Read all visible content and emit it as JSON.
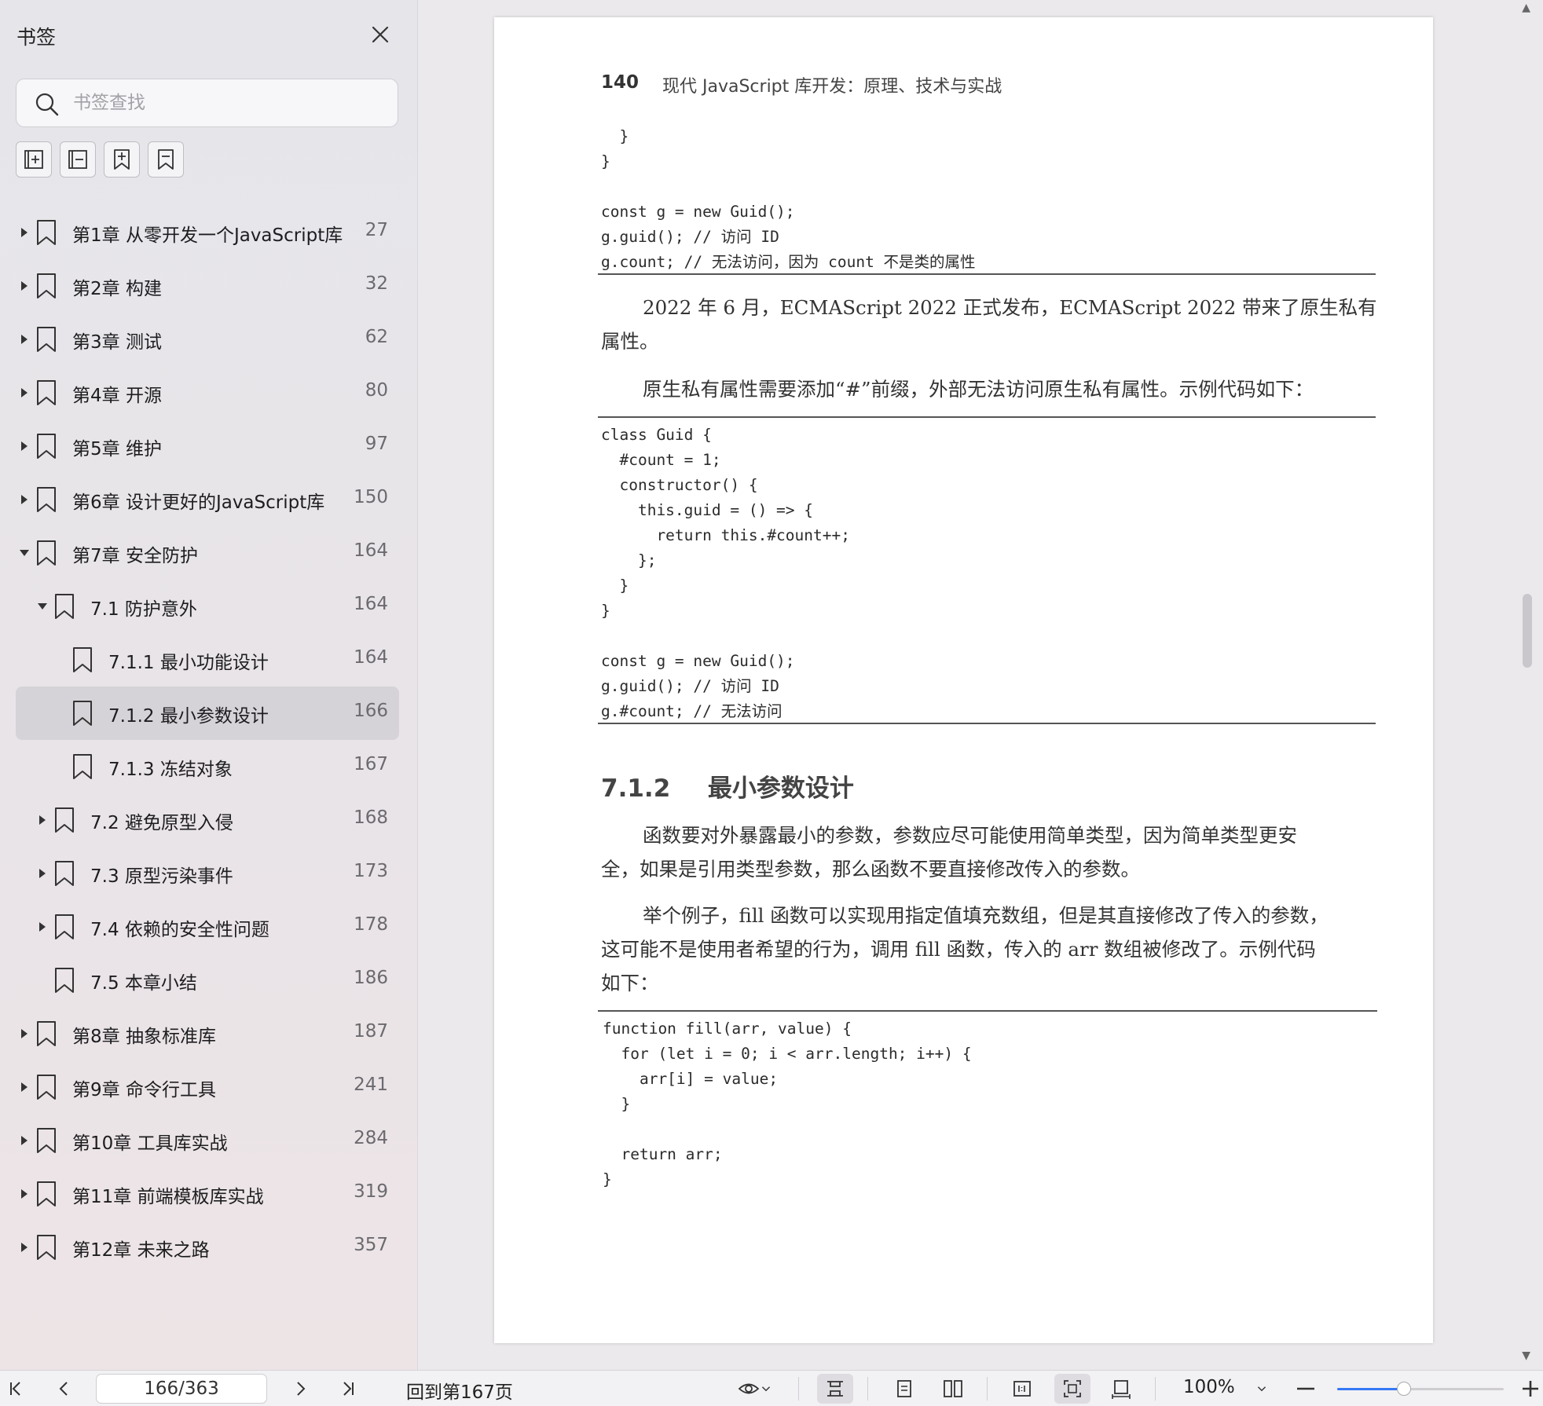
{
  "sidebar": {
    "title": "书签",
    "search_placeholder": "书签查找",
    "tools": [
      "expand-all-icon",
      "collapse-all-icon",
      "add-bookmark-icon",
      "remove-bookmark-icon"
    ],
    "bookmarks": [
      {
        "label": "第1章 从零开发一个JavaScript库",
        "page": "27",
        "level": 0,
        "state": "collapsed"
      },
      {
        "label": "第2章 构建",
        "page": "32",
        "level": 0,
        "state": "collapsed"
      },
      {
        "label": "第3章 测试",
        "page": "62",
        "level": 0,
        "state": "collapsed"
      },
      {
        "label": "第4章 开源",
        "page": "80",
        "level": 0,
        "state": "collapsed"
      },
      {
        "label": "第5章 维护",
        "page": "97",
        "level": 0,
        "state": "collapsed"
      },
      {
        "label": "第6章 设计更好的JavaScript库",
        "page": "150",
        "level": 0,
        "state": "collapsed"
      },
      {
        "label": "第7章 安全防护",
        "page": "164",
        "level": 0,
        "state": "expanded"
      },
      {
        "label": "7.1 防护意外",
        "page": "164",
        "level": 1,
        "state": "expanded"
      },
      {
        "label": "7.1.1 最小功能设计",
        "page": "164",
        "level": 2,
        "state": "leaf"
      },
      {
        "label": "7.1.2 最小参数设计",
        "page": "166",
        "level": 2,
        "state": "leaf",
        "selected": true
      },
      {
        "label": "7.1.3 冻结对象",
        "page": "167",
        "level": 2,
        "state": "leaf"
      },
      {
        "label": "7.2 避免原型入侵",
        "page": "168",
        "level": 1,
        "state": "collapsed"
      },
      {
        "label": "7.3 原型污染事件",
        "page": "173",
        "level": 1,
        "state": "collapsed"
      },
      {
        "label": "7.4 依赖的安全性问题",
        "page": "178",
        "level": 1,
        "state": "collapsed"
      },
      {
        "label": "7.5 本章小结",
        "page": "186",
        "level": 1,
        "state": "leaf"
      },
      {
        "label": "第8章 抽象标准库",
        "page": "187",
        "level": 0,
        "state": "collapsed"
      },
      {
        "label": "第9章 命令行工具",
        "page": "241",
        "level": 0,
        "state": "collapsed"
      },
      {
        "label": "第10章 工具库实战",
        "page": "284",
        "level": 0,
        "state": "collapsed"
      },
      {
        "label": "第11章 前端模板库实战",
        "page": "319",
        "level": 0,
        "state": "collapsed"
      },
      {
        "label": "第12章 未来之路",
        "page": "357",
        "level": 0,
        "state": "collapsed"
      }
    ]
  },
  "document": {
    "page_number": "140",
    "running_header": "现代 JavaScript 库开发：原理、技术与实战",
    "code_block_1": "  }\n}\n\nconst g = new Guid();\ng.guid(); // 访问 ID\ng.count; // 无法访问，因为 count 不是类的属性",
    "para_1_line_1": "2022 年 6 月，ECMAScript 2022 正式发布，ECMAScript 2022 带来了原生私有",
    "para_1_line_2": "属性。",
    "para_2": "原生私有属性需要添加“#”前缀，外部无法访问原生私有属性。示例代码如下：",
    "code_block_2": "class Guid {\n  #count = 1;\n  constructor() {\n    this.guid = () => {\n      return this.#count++;\n    };\n  }\n}\n\nconst g = new Guid();\ng.guid(); // 访问 ID\ng.#count; // 无法访问",
    "section_number": "7.1.2",
    "section_title": "最小参数设计",
    "para_3_line_1": "函数要对外暴露最小的参数，参数应尽可能使用简单类型，因为简单类型更安",
    "para_3_line_2": "全，如果是引用类型参数，那么函数不要直接修改传入的参数。",
    "para_4_line_1": "举个例子，fill 函数可以实现用指定值填充数组，但是其直接修改了传入的参数，",
    "para_4_line_2": "这可能不是使用者希望的行为，调用 fill 函数，传入的 arr 数组被修改了。示例代码",
    "para_4_line_3": "如下：",
    "code_block_3": "function fill(arr, value) {\n  for (let i = 0; i < arr.length; i++) {\n    arr[i] = value;\n  }\n\n  return arr;\n}"
  },
  "toolbar": {
    "page_field": "166/363",
    "back_to_label": "回到第167页",
    "zoom_label": "100%",
    "zoom_slider_fraction": 0.4
  },
  "colors": {
    "accent": "#3478f6",
    "selected_row": "#d6d3d8"
  }
}
